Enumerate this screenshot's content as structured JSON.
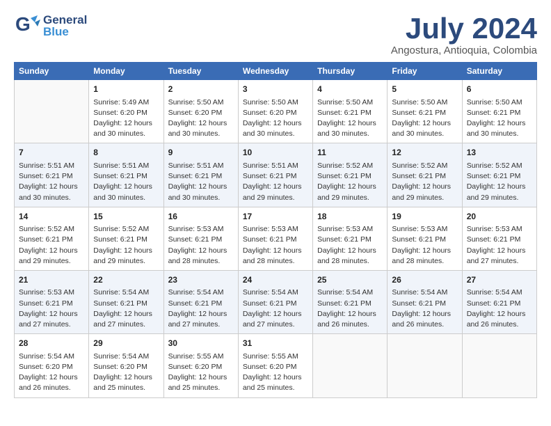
{
  "logo": {
    "general": "General",
    "blue": "Blue"
  },
  "title": "July 2024",
  "subtitle": "Angostura, Antioquia, Colombia",
  "days_header": [
    "Sunday",
    "Monday",
    "Tuesday",
    "Wednesday",
    "Thursday",
    "Friday",
    "Saturday"
  ],
  "weeks": [
    [
      {
        "day": "",
        "lines": []
      },
      {
        "day": "1",
        "lines": [
          "Sunrise: 5:49 AM",
          "Sunset: 6:20 PM",
          "Daylight: 12 hours",
          "and 30 minutes."
        ]
      },
      {
        "day": "2",
        "lines": [
          "Sunrise: 5:50 AM",
          "Sunset: 6:20 PM",
          "Daylight: 12 hours",
          "and 30 minutes."
        ]
      },
      {
        "day": "3",
        "lines": [
          "Sunrise: 5:50 AM",
          "Sunset: 6:20 PM",
          "Daylight: 12 hours",
          "and 30 minutes."
        ]
      },
      {
        "day": "4",
        "lines": [
          "Sunrise: 5:50 AM",
          "Sunset: 6:21 PM",
          "Daylight: 12 hours",
          "and 30 minutes."
        ]
      },
      {
        "day": "5",
        "lines": [
          "Sunrise: 5:50 AM",
          "Sunset: 6:21 PM",
          "Daylight: 12 hours",
          "and 30 minutes."
        ]
      },
      {
        "day": "6",
        "lines": [
          "Sunrise: 5:50 AM",
          "Sunset: 6:21 PM",
          "Daylight: 12 hours",
          "and 30 minutes."
        ]
      }
    ],
    [
      {
        "day": "7",
        "lines": [
          "Sunrise: 5:51 AM",
          "Sunset: 6:21 PM",
          "Daylight: 12 hours",
          "and 30 minutes."
        ]
      },
      {
        "day": "8",
        "lines": [
          "Sunrise: 5:51 AM",
          "Sunset: 6:21 PM",
          "Daylight: 12 hours",
          "and 30 minutes."
        ]
      },
      {
        "day": "9",
        "lines": [
          "Sunrise: 5:51 AM",
          "Sunset: 6:21 PM",
          "Daylight: 12 hours",
          "and 30 minutes."
        ]
      },
      {
        "day": "10",
        "lines": [
          "Sunrise: 5:51 AM",
          "Sunset: 6:21 PM",
          "Daylight: 12 hours",
          "and 29 minutes."
        ]
      },
      {
        "day": "11",
        "lines": [
          "Sunrise: 5:52 AM",
          "Sunset: 6:21 PM",
          "Daylight: 12 hours",
          "and 29 minutes."
        ]
      },
      {
        "day": "12",
        "lines": [
          "Sunrise: 5:52 AM",
          "Sunset: 6:21 PM",
          "Daylight: 12 hours",
          "and 29 minutes."
        ]
      },
      {
        "day": "13",
        "lines": [
          "Sunrise: 5:52 AM",
          "Sunset: 6:21 PM",
          "Daylight: 12 hours",
          "and 29 minutes."
        ]
      }
    ],
    [
      {
        "day": "14",
        "lines": [
          "Sunrise: 5:52 AM",
          "Sunset: 6:21 PM",
          "Daylight: 12 hours",
          "and 29 minutes."
        ]
      },
      {
        "day": "15",
        "lines": [
          "Sunrise: 5:52 AM",
          "Sunset: 6:21 PM",
          "Daylight: 12 hours",
          "and 29 minutes."
        ]
      },
      {
        "day": "16",
        "lines": [
          "Sunrise: 5:53 AM",
          "Sunset: 6:21 PM",
          "Daylight: 12 hours",
          "and 28 minutes."
        ]
      },
      {
        "day": "17",
        "lines": [
          "Sunrise: 5:53 AM",
          "Sunset: 6:21 PM",
          "Daylight: 12 hours",
          "and 28 minutes."
        ]
      },
      {
        "day": "18",
        "lines": [
          "Sunrise: 5:53 AM",
          "Sunset: 6:21 PM",
          "Daylight: 12 hours",
          "and 28 minutes."
        ]
      },
      {
        "day": "19",
        "lines": [
          "Sunrise: 5:53 AM",
          "Sunset: 6:21 PM",
          "Daylight: 12 hours",
          "and 28 minutes."
        ]
      },
      {
        "day": "20",
        "lines": [
          "Sunrise: 5:53 AM",
          "Sunset: 6:21 PM",
          "Daylight: 12 hours",
          "and 27 minutes."
        ]
      }
    ],
    [
      {
        "day": "21",
        "lines": [
          "Sunrise: 5:53 AM",
          "Sunset: 6:21 PM",
          "Daylight: 12 hours",
          "and 27 minutes."
        ]
      },
      {
        "day": "22",
        "lines": [
          "Sunrise: 5:54 AM",
          "Sunset: 6:21 PM",
          "Daylight: 12 hours",
          "and 27 minutes."
        ]
      },
      {
        "day": "23",
        "lines": [
          "Sunrise: 5:54 AM",
          "Sunset: 6:21 PM",
          "Daylight: 12 hours",
          "and 27 minutes."
        ]
      },
      {
        "day": "24",
        "lines": [
          "Sunrise: 5:54 AM",
          "Sunset: 6:21 PM",
          "Daylight: 12 hours",
          "and 27 minutes."
        ]
      },
      {
        "day": "25",
        "lines": [
          "Sunrise: 5:54 AM",
          "Sunset: 6:21 PM",
          "Daylight: 12 hours",
          "and 26 minutes."
        ]
      },
      {
        "day": "26",
        "lines": [
          "Sunrise: 5:54 AM",
          "Sunset: 6:21 PM",
          "Daylight: 12 hours",
          "and 26 minutes."
        ]
      },
      {
        "day": "27",
        "lines": [
          "Sunrise: 5:54 AM",
          "Sunset: 6:21 PM",
          "Daylight: 12 hours",
          "and 26 minutes."
        ]
      }
    ],
    [
      {
        "day": "28",
        "lines": [
          "Sunrise: 5:54 AM",
          "Sunset: 6:20 PM",
          "Daylight: 12 hours",
          "and 26 minutes."
        ]
      },
      {
        "day": "29",
        "lines": [
          "Sunrise: 5:54 AM",
          "Sunset: 6:20 PM",
          "Daylight: 12 hours",
          "and 25 minutes."
        ]
      },
      {
        "day": "30",
        "lines": [
          "Sunrise: 5:55 AM",
          "Sunset: 6:20 PM",
          "Daylight: 12 hours",
          "and 25 minutes."
        ]
      },
      {
        "day": "31",
        "lines": [
          "Sunrise: 5:55 AM",
          "Sunset: 6:20 PM",
          "Daylight: 12 hours",
          "and 25 minutes."
        ]
      },
      {
        "day": "",
        "lines": []
      },
      {
        "day": "",
        "lines": []
      },
      {
        "day": "",
        "lines": []
      }
    ]
  ]
}
